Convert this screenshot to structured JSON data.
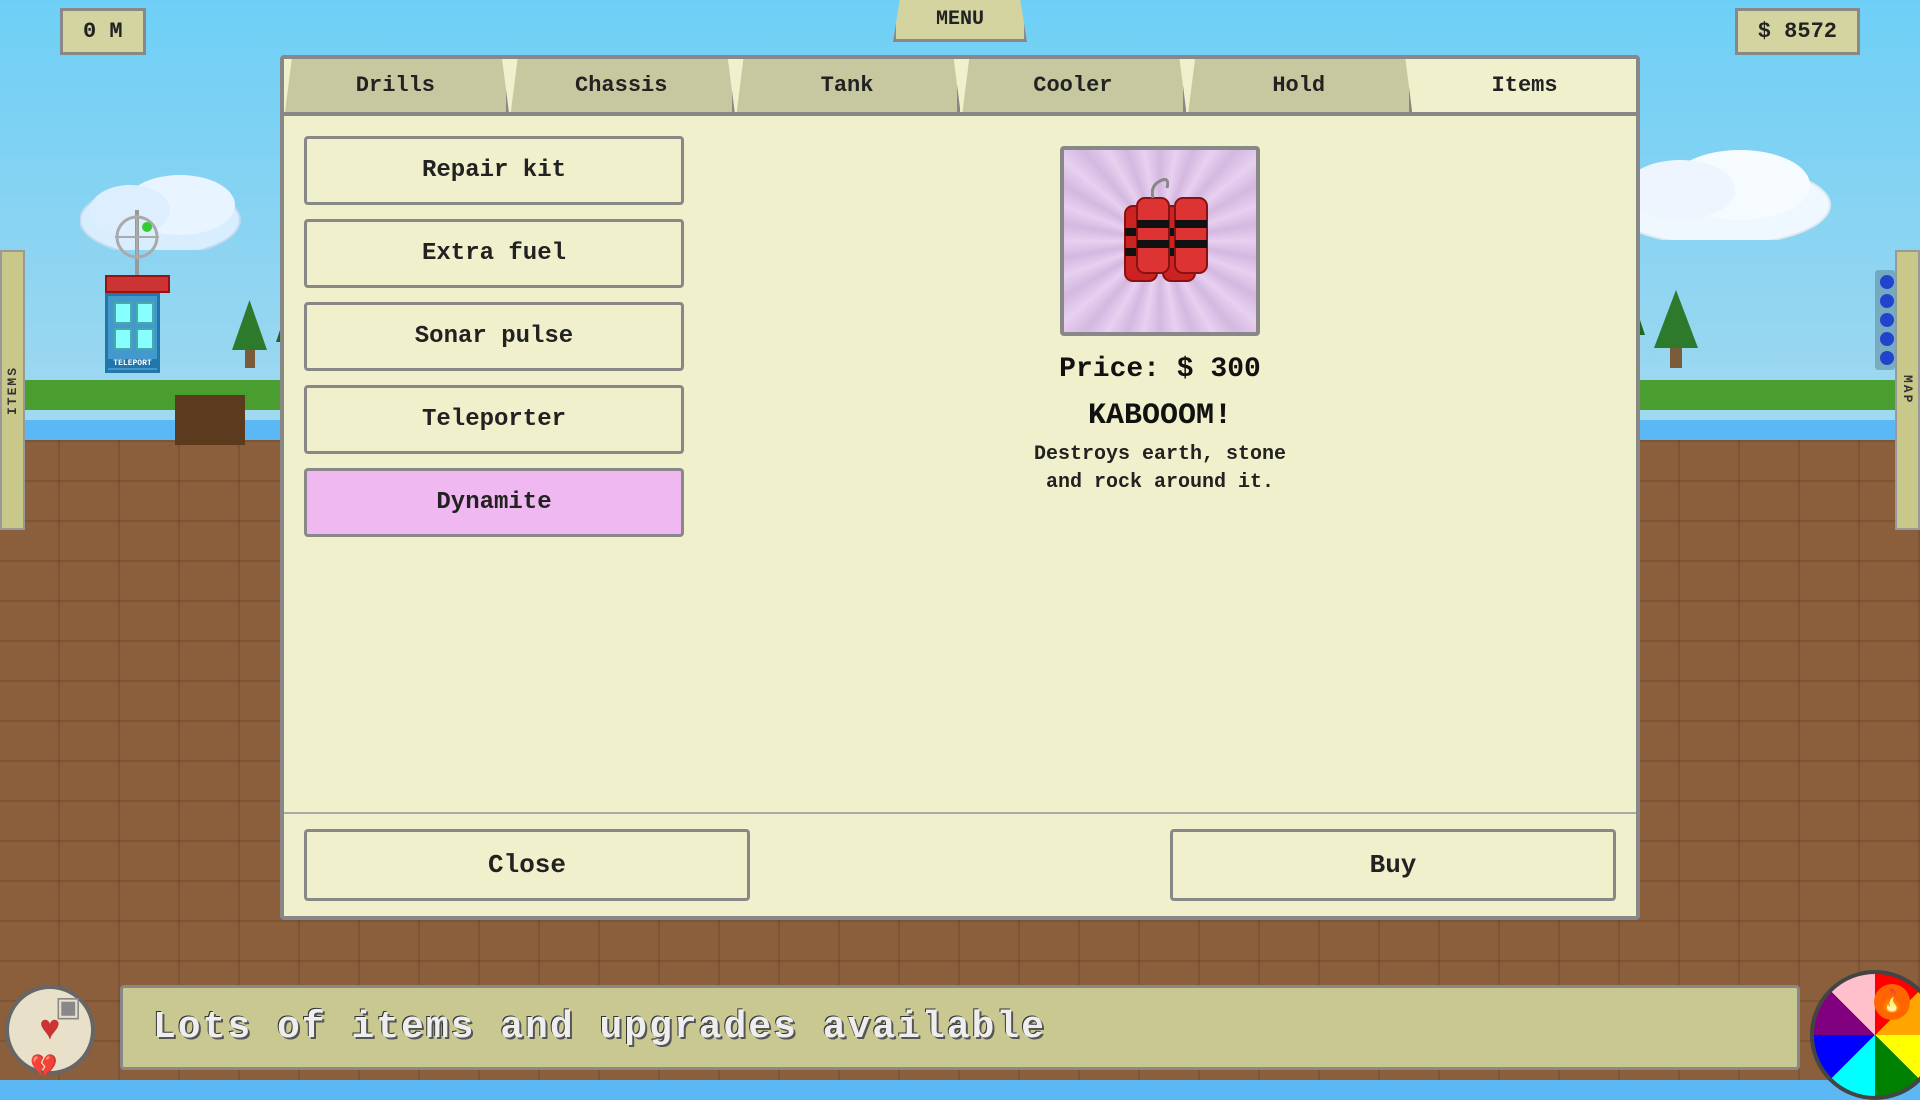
{
  "hud": {
    "depth": "0 M",
    "money": "$ 8572",
    "menu_label": "MENU"
  },
  "tabs": [
    {
      "id": "drills",
      "label": "Drills",
      "active": false
    },
    {
      "id": "chassis",
      "label": "Chassis",
      "active": false
    },
    {
      "id": "tank",
      "label": "Tank",
      "active": false
    },
    {
      "id": "cooler",
      "label": "Cooler",
      "active": false
    },
    {
      "id": "hold",
      "label": "Hold",
      "active": false
    },
    {
      "id": "items",
      "label": "Items",
      "active": true
    }
  ],
  "items": [
    {
      "id": "repair-kit",
      "label": "Repair kit",
      "selected": false
    },
    {
      "id": "extra-fuel",
      "label": "Extra fuel",
      "selected": false
    },
    {
      "id": "sonar-pulse",
      "label": "Sonar pulse",
      "selected": false
    },
    {
      "id": "teleporter",
      "label": "Teleporter",
      "selected": false
    },
    {
      "id": "dynamite",
      "label": "Dynamite",
      "selected": true
    }
  ],
  "selected_item": {
    "price_label": "Price: $ 300",
    "name": "KABOOOM!",
    "description": "Destroys earth, stone\nand rock around it."
  },
  "buttons": {
    "close": "Close",
    "buy": "Buy"
  },
  "side_panels": {
    "left": "ITEMS",
    "right": "MAP"
  },
  "status_bar": {
    "text": "Lots of items and upgrades available"
  },
  "dots": [
    {
      "color": "#2244cc"
    },
    {
      "color": "#2244cc"
    },
    {
      "color": "#2244cc"
    },
    {
      "color": "#2244cc"
    },
    {
      "color": "#2244cc"
    }
  ]
}
